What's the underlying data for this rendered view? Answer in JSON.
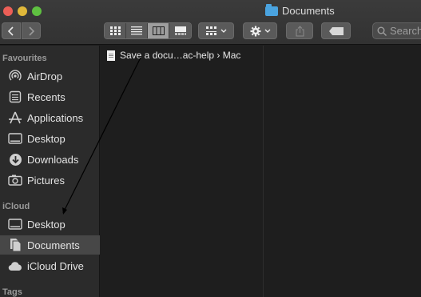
{
  "window": {
    "title": "Documents"
  },
  "toolbar": {
    "search_placeholder": "Search"
  },
  "sidebar": {
    "sections": [
      {
        "heading": "Favourites"
      },
      {
        "heading": "iCloud"
      },
      {
        "heading": "Tags"
      }
    ],
    "items": [
      {
        "label": "AirDrop",
        "icon": "airdrop-icon"
      },
      {
        "label": "Recents",
        "icon": "recents-icon"
      },
      {
        "label": "Applications",
        "icon": "applications-icon"
      },
      {
        "label": "Desktop",
        "icon": "desktop-icon"
      },
      {
        "label": "Downloads",
        "icon": "downloads-icon"
      },
      {
        "label": "Pictures",
        "icon": "pictures-icon"
      },
      {
        "label": "Desktop",
        "icon": "desktop-icon"
      },
      {
        "label": "Documents",
        "icon": "documents-icon",
        "selected": true
      },
      {
        "label": "iCloud Drive",
        "icon": "cloud-icon"
      }
    ]
  },
  "files": [
    {
      "name": "Save a docu…ac-help › Mac",
      "icon": "document-icon"
    }
  ],
  "colors": {
    "folder_accent": "#4aa3df",
    "selection": "#474747"
  }
}
